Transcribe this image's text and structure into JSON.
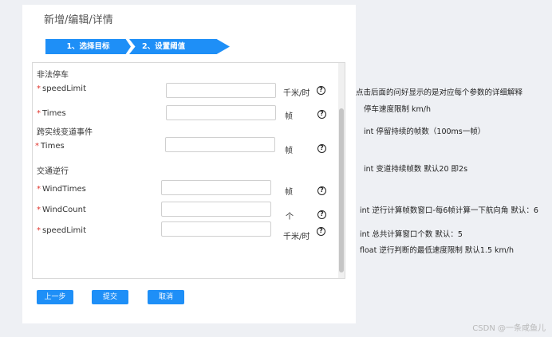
{
  "page": {
    "title": "新增/编辑/详情"
  },
  "steps": [
    {
      "label": "1、选择目标"
    },
    {
      "label": "2、设置阈值"
    }
  ],
  "form": {
    "sections": {
      "illegal_parking": "非法停车",
      "lane_crossing": "跨实线变道事件",
      "wrong_way": "交通逆行"
    },
    "fields": [
      {
        "label": "speedLimit",
        "unit": "千米/时",
        "value": ""
      },
      {
        "label": "Times",
        "unit": "帧",
        "value": ""
      },
      {
        "label": "Times",
        "unit": "帧",
        "value": ""
      },
      {
        "label": "WindTimes",
        "unit": "帧",
        "value": ""
      },
      {
        "label": "WindCount",
        "unit": "个",
        "value": ""
      },
      {
        "label": "speedLimit",
        "unit": "千米/时",
        "value": ""
      }
    ],
    "required_mark": "*",
    "help_icon": "?"
  },
  "buttons": {
    "prev": "上一步",
    "submit": "提交",
    "cancel": "取消"
  },
  "notes": {
    "header": "点击后面的问好显示的是对应每个参数的详细解释",
    "n1": "停车速度限制 km/h",
    "n2": "int 停留持续的帧数（100ms一帧）",
    "n3": "int 变道持续帧数 默认20 即2s",
    "n4": "int 逆行计算帧数窗口-每6帧计算一下航向角 默认：6",
    "n5": "int 总共计算窗口个数 默认：5",
    "n6": "float 逆行判断的最低速度限制 默认1.5 km/h"
  },
  "watermark": "CSDN @一条咸鱼儿",
  "colors": {
    "primary": "#1e8ff7",
    "required": "#e0332b",
    "background": "#eef0f4"
  }
}
